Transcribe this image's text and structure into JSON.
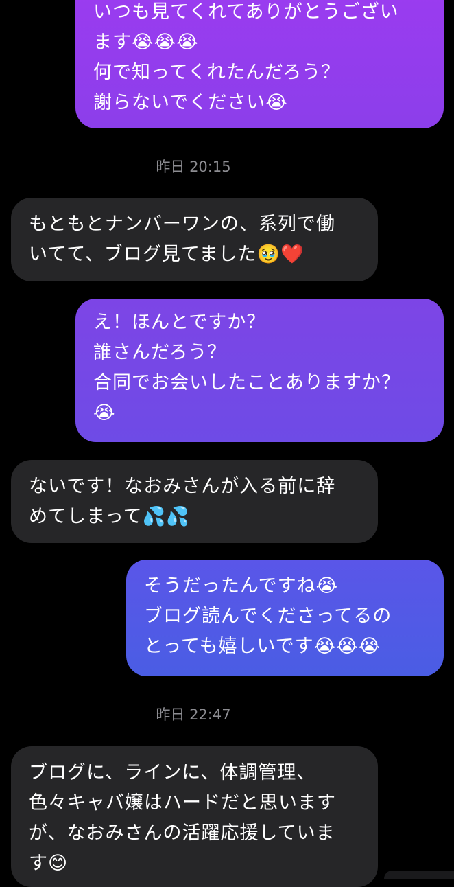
{
  "conversation": {
    "messages": [
      {
        "direction": "sent",
        "lines": [
          "いつも見てくれてありがとうござい",
          "ます😭😭😭",
          "何で知ってくれたんだろう？",
          "謝らないでください😭"
        ]
      },
      {
        "direction": "received",
        "lines": [
          "もともとナンバーワンの、系列で働",
          "いてて、ブログ見てました🥹❤️"
        ]
      },
      {
        "direction": "sent",
        "lines": [
          "え！ほんとですか？",
          "誰さんだろう？",
          "合同でお会いしたことありますか？",
          "😭"
        ]
      },
      {
        "direction": "received",
        "lines": [
          "ないです！なおみさんが入る前に辞",
          "めてしまって💦💦"
        ]
      },
      {
        "direction": "sent",
        "lines": [
          "そうだったんですね😭",
          "ブログ読んでくださってるの",
          "とっても嬉しいです😭😭😭"
        ]
      },
      {
        "direction": "received",
        "lines": [
          "ブログに、ラインに、体調管理、",
          "色々キャバ嬢はハードだと思います",
          "が、なおみさんの活躍応援していま",
          "す😊"
        ]
      }
    ],
    "timestamps": [
      "昨日 20:15",
      "昨日 22:47"
    ]
  },
  "colors": {
    "background": "#000000",
    "received_bubble": "#262628",
    "sent_gradient_top": "#9b3cf0",
    "sent_gradient_bottom": "#4a5de4",
    "timestamp_text": "#8d8d92"
  }
}
